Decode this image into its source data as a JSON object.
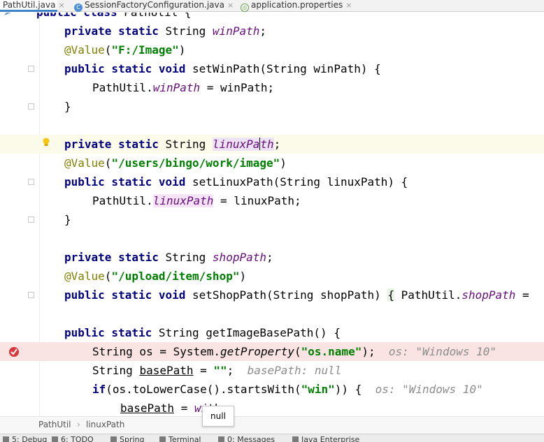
{
  "tabs": [
    {
      "label": "PathUtil.java",
      "active": true,
      "icon": "java-class-icon"
    },
    {
      "label": "SessionFactoryConfiguration.java",
      "active": false,
      "icon": "java-class-icon"
    },
    {
      "label": "application.properties",
      "active": false,
      "icon": "properties-file-icon"
    }
  ],
  "tab_close_glyph": "×",
  "code": {
    "l0": {
      "kw": "public class",
      "rest": " PathUtil {"
    },
    "l1": {
      "kw": "private static",
      "type": " String ",
      "field": "winPath",
      "end": ";"
    },
    "l2": {
      "ann": "@Value",
      "open": "(",
      "str": "\"F:/Image\"",
      "close": ")"
    },
    "l3": {
      "kw": "public static void",
      "rest": " setWinPath(String winPath) {"
    },
    "l4": {
      "cls": "PathUtil.",
      "field": "winPath",
      "rest": " = winPath;"
    },
    "l5": {
      "rest": "}"
    },
    "l7": {
      "kw": "private static",
      "type": " String ",
      "field_a": "linuxPa",
      "field_b": "th",
      "end": ";"
    },
    "l8": {
      "ann": "@Value",
      "open": "(",
      "str": "\"/users/bingo/work/image\"",
      "close": ")"
    },
    "l9": {
      "kw": "public static void",
      "rest": " setLinuxPath(String linuxPath) {"
    },
    "l10": {
      "cls": "PathUtil.",
      "field": "linuxPath",
      "rest": " = linuxPath;"
    },
    "l11": {
      "rest": "}"
    },
    "l13": {
      "kw": "private static",
      "type": " String ",
      "field": "shopPath",
      "end": ";"
    },
    "l14": {
      "ann": "@Value",
      "open": "(",
      "str": "\"/upload/item/shop\"",
      "close": ")"
    },
    "l15": {
      "kw": "public static void",
      "rest": " setShopPath(String shopPath) ",
      "brace": "{",
      "cls": " PathUtil.",
      "field": "shopPath",
      "tail": " ="
    },
    "l17": {
      "kw": "public static",
      "rest": " String getImageBasePath() {"
    },
    "l18": {
      "a": "String os = System.",
      "meth": "getProperty",
      "open": "(",
      "str": "\"os.name\"",
      "close": ");",
      "inline": "os: \"Windows 10\""
    },
    "l19": {
      "a": "String ",
      "var": "basePath",
      "b": " = ",
      "str": "\"\"",
      "c": ";",
      "inline": "basePath: null"
    },
    "l20": {
      "kw": "if",
      "a": "(os.toLowerCase().startsWith(",
      "str": "\"win\"",
      "b": ")) {",
      "inline": "os: \"Windows 10\""
    },
    "l21": {
      "var": "basePath",
      "a": " = ",
      "hidden": "wi",
      "b": "th;"
    }
  },
  "tooltip": {
    "text": "null"
  },
  "breadcrumb": {
    "class_name": "PathUtil",
    "separator": "›",
    "field_name": "linuxPath"
  },
  "tool_windows": [
    {
      "label": "5: Debug",
      "icon": "debug-icon"
    },
    {
      "label": "6: TODO",
      "icon": "todo-icon"
    },
    {
      "label": "Spring",
      "icon": "spring-icon"
    },
    {
      "label": "Terminal",
      "icon": "terminal-icon"
    },
    {
      "label": "0: Messages",
      "icon": "messages-icon"
    },
    {
      "label": "Java Enterprise",
      "icon": "java-enterprise-icon"
    }
  ],
  "colors": {
    "keyword": "#000080",
    "string": "#008000",
    "annotation": "#808000",
    "field": "#660e7a",
    "inline_value": "#8c8c8c",
    "caret_row": "#fcfae8",
    "breakpoint_row": "#fae3e3",
    "active_tab_underline": "#4083c9"
  }
}
